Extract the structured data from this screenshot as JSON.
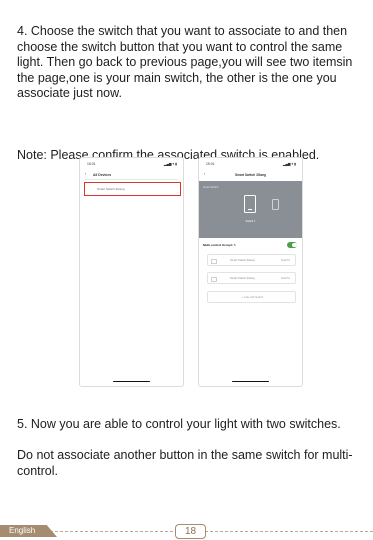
{
  "step4": "4. Choose the switch that you want to associate to and then choose the switch button that you want to control the same light. Then go back to previous page,you will see two itemsin the page,one is your main switch, the other is the one you associate just now.",
  "note": "Note: Please confirm the associated switch is enabled.",
  "step5_line1": "5. Now you are able to control your light with two switches.",
  "step5_line2": "Do not associate another button in the same switch for multi-control.",
  "phone_left": {
    "time": "15:01",
    "status_icons": "▂▄▆ ▾ ▮",
    "back": "‹",
    "title": "All Devices",
    "row_label": "Smart Switch 3Gang"
  },
  "phone_right": {
    "time": "15:01",
    "status_icons": "▂▄▆ ▾ ▮",
    "back": "‹",
    "title": "Smart Switch 3Gang",
    "hero_label": "Smart Switch",
    "switch_caption": "Switch 1",
    "multi_control_label": "Multi-control Group1 ✎",
    "rows": [
      {
        "name": "Smart Switch 3Gang",
        "button": "Switch1"
      },
      {
        "name": "Smart Switch 3Gang",
        "button": "Switch1"
      }
    ],
    "add_label": "+  Link with Switch",
    "toggle_on": true,
    "toggle_color": "#4aa04a"
  },
  "footer": {
    "language": "English",
    "page": "18"
  },
  "colors": {
    "accent": "#a58c70",
    "highlight_border": "#d9352b"
  }
}
